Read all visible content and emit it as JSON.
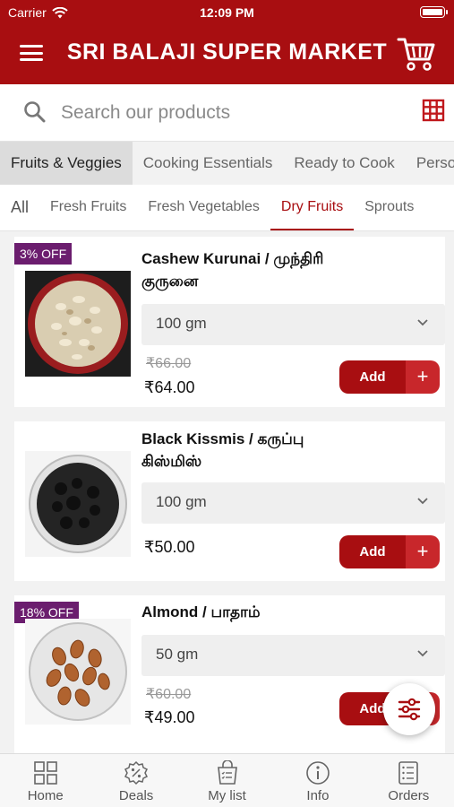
{
  "status_bar": {
    "carrier": "Carrier",
    "time": "12:09 PM"
  },
  "header": {
    "title": "SRI BALAJI SUPER MARKET",
    "menu_icon": "hamburger-icon",
    "cart_icon": "cart-icon"
  },
  "search": {
    "placeholder": "Search our products"
  },
  "categories": [
    {
      "label": "Fruits & Veggies",
      "active": true
    },
    {
      "label": "Cooking Essentials"
    },
    {
      "label": "Ready to Cook"
    },
    {
      "label": "Personal Care"
    }
  ],
  "subcategories": [
    {
      "label": "All"
    },
    {
      "label": "Fresh Fruits"
    },
    {
      "label": "Fresh Vegetables"
    },
    {
      "label": "Dry Fruits",
      "active": true
    },
    {
      "label": "Sprouts"
    }
  ],
  "products": [
    {
      "badge": "3% OFF",
      "name": "Cashew Kurunai / முந்திரி குருனை",
      "variant": "100 gm",
      "mrp": "₹66.00",
      "price": "₹64.00",
      "add_label": "Add"
    },
    {
      "badge": "",
      "name": "Black Kissmis / கருப்பு கிஸ்மிஸ்",
      "variant": "100 gm",
      "mrp": "",
      "price": "₹50.00",
      "add_label": "Add"
    },
    {
      "badge": "18% OFF",
      "name": "Almond / பாதாம்",
      "variant": "50 gm",
      "mrp": "₹60.00",
      "price": "₹49.00",
      "add_label": "Add"
    }
  ],
  "bottom_nav": [
    {
      "label": "Home",
      "icon": "home-grid-icon"
    },
    {
      "label": "Deals",
      "icon": "deals-badge-icon"
    },
    {
      "label": "My list",
      "icon": "list-bag-icon"
    },
    {
      "label": "Info",
      "icon": "info-icon"
    },
    {
      "label": "Orders",
      "icon": "orders-icon"
    }
  ],
  "colors": {
    "brand": "#a80e11",
    "badge": "#6b1d6e"
  }
}
